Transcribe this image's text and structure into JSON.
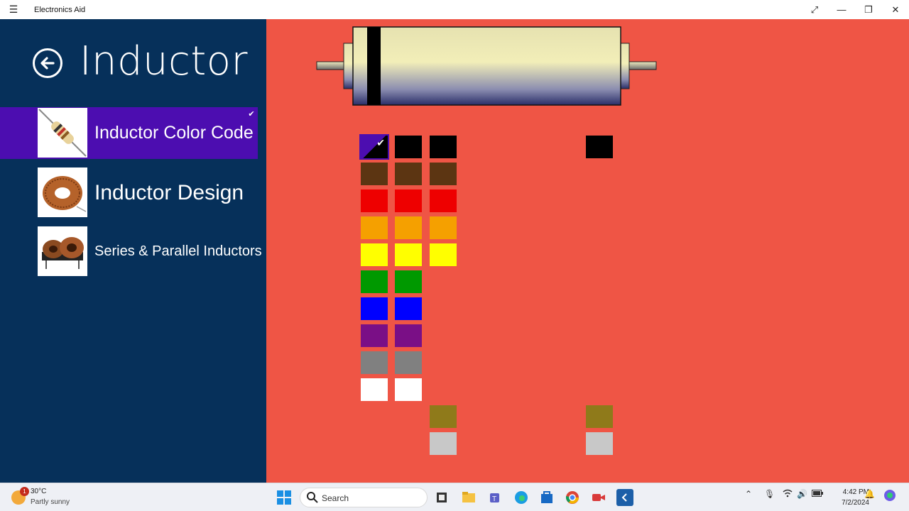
{
  "window": {
    "app_title": "Electronics Aid",
    "menu_icon": "hamburger-icon",
    "controls": [
      "expand-icon",
      "minimize-icon",
      "restore-icon",
      "close-icon"
    ]
  },
  "sidebar": {
    "page_title": "Inductor",
    "back_icon": "back-arrow-icon",
    "items": [
      {
        "label": "Inductor Color Code",
        "selected": true,
        "icon": "color-coded-inductor-image"
      },
      {
        "label": "Inductor Design",
        "selected": false,
        "icon": "toroid-inductor-image"
      },
      {
        "label": "Series & Parallel Inductors",
        "selected": false,
        "icon": "paired-inductors-image"
      }
    ],
    "colors": {
      "pane": "#06305a",
      "selected": "#4c0db0"
    }
  },
  "color_code": {
    "background": "#ef5545",
    "inductor_band_color": "#000000",
    "band1_options": [
      "#000000",
      "#5c3512",
      "#ee0000",
      "#f5a000",
      "#ffff00",
      "#009900",
      "#0000ff",
      "#7a0f86",
      "#808080",
      "#ffffff"
    ],
    "band2_options": [
      "#000000",
      "#5c3512",
      "#ee0000",
      "#f5a000",
      "#ffff00",
      "#009900",
      "#0000ff",
      "#7a0f86",
      "#808080",
      "#ffffff"
    ],
    "multiplier_options": [
      "#000000",
      "#5c3512",
      "#ee0000",
      "#f5a000",
      "#ffff00",
      "#8f7a1a",
      "#c8c8c8"
    ],
    "tolerance_options": [
      "#000000",
      "#8f7a1a",
      "#c8c8c8"
    ],
    "selected_band1_index": 0
  },
  "taskbar": {
    "weather_temp": "30°C",
    "weather_desc": "Partly sunny",
    "weather_badge": "1",
    "search_placeholder": "Search",
    "time": "4:42 PM",
    "date": "7/2/2024"
  }
}
